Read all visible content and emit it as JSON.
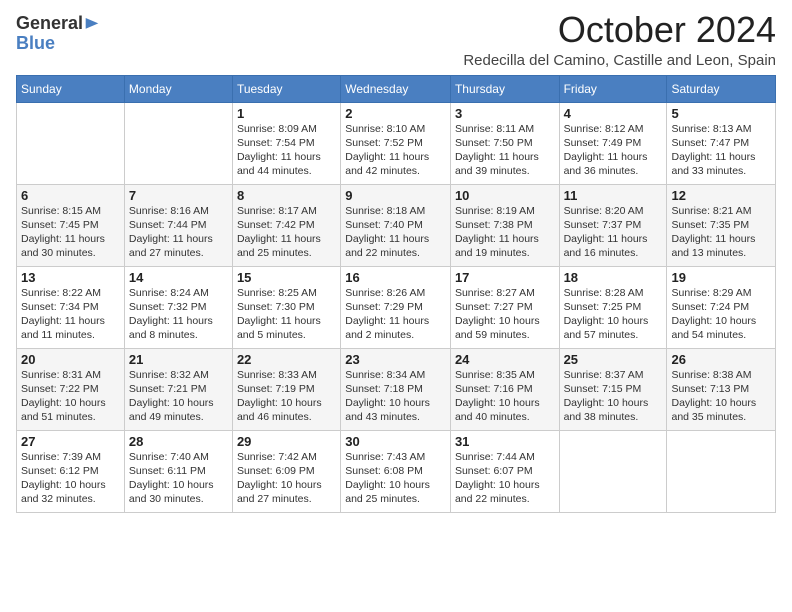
{
  "logo": {
    "general": "General",
    "blue": "Blue"
  },
  "title": "October 2024",
  "subtitle": "Redecilla del Camino, Castille and Leon, Spain",
  "days_of_week": [
    "Sunday",
    "Monday",
    "Tuesday",
    "Wednesday",
    "Thursday",
    "Friday",
    "Saturday"
  ],
  "weeks": [
    [
      {
        "day": "",
        "info": ""
      },
      {
        "day": "",
        "info": ""
      },
      {
        "day": "1",
        "info": "Sunrise: 8:09 AM\nSunset: 7:54 PM\nDaylight: 11 hours and 44 minutes."
      },
      {
        "day": "2",
        "info": "Sunrise: 8:10 AM\nSunset: 7:52 PM\nDaylight: 11 hours and 42 minutes."
      },
      {
        "day": "3",
        "info": "Sunrise: 8:11 AM\nSunset: 7:50 PM\nDaylight: 11 hours and 39 minutes."
      },
      {
        "day": "4",
        "info": "Sunrise: 8:12 AM\nSunset: 7:49 PM\nDaylight: 11 hours and 36 minutes."
      },
      {
        "day": "5",
        "info": "Sunrise: 8:13 AM\nSunset: 7:47 PM\nDaylight: 11 hours and 33 minutes."
      }
    ],
    [
      {
        "day": "6",
        "info": "Sunrise: 8:15 AM\nSunset: 7:45 PM\nDaylight: 11 hours and 30 minutes."
      },
      {
        "day": "7",
        "info": "Sunrise: 8:16 AM\nSunset: 7:44 PM\nDaylight: 11 hours and 27 minutes."
      },
      {
        "day": "8",
        "info": "Sunrise: 8:17 AM\nSunset: 7:42 PM\nDaylight: 11 hours and 25 minutes."
      },
      {
        "day": "9",
        "info": "Sunrise: 8:18 AM\nSunset: 7:40 PM\nDaylight: 11 hours and 22 minutes."
      },
      {
        "day": "10",
        "info": "Sunrise: 8:19 AM\nSunset: 7:38 PM\nDaylight: 11 hours and 19 minutes."
      },
      {
        "day": "11",
        "info": "Sunrise: 8:20 AM\nSunset: 7:37 PM\nDaylight: 11 hours and 16 minutes."
      },
      {
        "day": "12",
        "info": "Sunrise: 8:21 AM\nSunset: 7:35 PM\nDaylight: 11 hours and 13 minutes."
      }
    ],
    [
      {
        "day": "13",
        "info": "Sunrise: 8:22 AM\nSunset: 7:34 PM\nDaylight: 11 hours and 11 minutes."
      },
      {
        "day": "14",
        "info": "Sunrise: 8:24 AM\nSunset: 7:32 PM\nDaylight: 11 hours and 8 minutes."
      },
      {
        "day": "15",
        "info": "Sunrise: 8:25 AM\nSunset: 7:30 PM\nDaylight: 11 hours and 5 minutes."
      },
      {
        "day": "16",
        "info": "Sunrise: 8:26 AM\nSunset: 7:29 PM\nDaylight: 11 hours and 2 minutes."
      },
      {
        "day": "17",
        "info": "Sunrise: 8:27 AM\nSunset: 7:27 PM\nDaylight: 10 hours and 59 minutes."
      },
      {
        "day": "18",
        "info": "Sunrise: 8:28 AM\nSunset: 7:25 PM\nDaylight: 10 hours and 57 minutes."
      },
      {
        "day": "19",
        "info": "Sunrise: 8:29 AM\nSunset: 7:24 PM\nDaylight: 10 hours and 54 minutes."
      }
    ],
    [
      {
        "day": "20",
        "info": "Sunrise: 8:31 AM\nSunset: 7:22 PM\nDaylight: 10 hours and 51 minutes."
      },
      {
        "day": "21",
        "info": "Sunrise: 8:32 AM\nSunset: 7:21 PM\nDaylight: 10 hours and 49 minutes."
      },
      {
        "day": "22",
        "info": "Sunrise: 8:33 AM\nSunset: 7:19 PM\nDaylight: 10 hours and 46 minutes."
      },
      {
        "day": "23",
        "info": "Sunrise: 8:34 AM\nSunset: 7:18 PM\nDaylight: 10 hours and 43 minutes."
      },
      {
        "day": "24",
        "info": "Sunrise: 8:35 AM\nSunset: 7:16 PM\nDaylight: 10 hours and 40 minutes."
      },
      {
        "day": "25",
        "info": "Sunrise: 8:37 AM\nSunset: 7:15 PM\nDaylight: 10 hours and 38 minutes."
      },
      {
        "day": "26",
        "info": "Sunrise: 8:38 AM\nSunset: 7:13 PM\nDaylight: 10 hours and 35 minutes."
      }
    ],
    [
      {
        "day": "27",
        "info": "Sunrise: 7:39 AM\nSunset: 6:12 PM\nDaylight: 10 hours and 32 minutes."
      },
      {
        "day": "28",
        "info": "Sunrise: 7:40 AM\nSunset: 6:11 PM\nDaylight: 10 hours and 30 minutes."
      },
      {
        "day": "29",
        "info": "Sunrise: 7:42 AM\nSunset: 6:09 PM\nDaylight: 10 hours and 27 minutes."
      },
      {
        "day": "30",
        "info": "Sunrise: 7:43 AM\nSunset: 6:08 PM\nDaylight: 10 hours and 25 minutes."
      },
      {
        "day": "31",
        "info": "Sunrise: 7:44 AM\nSunset: 6:07 PM\nDaylight: 10 hours and 22 minutes."
      },
      {
        "day": "",
        "info": ""
      },
      {
        "day": "",
        "info": ""
      }
    ]
  ]
}
